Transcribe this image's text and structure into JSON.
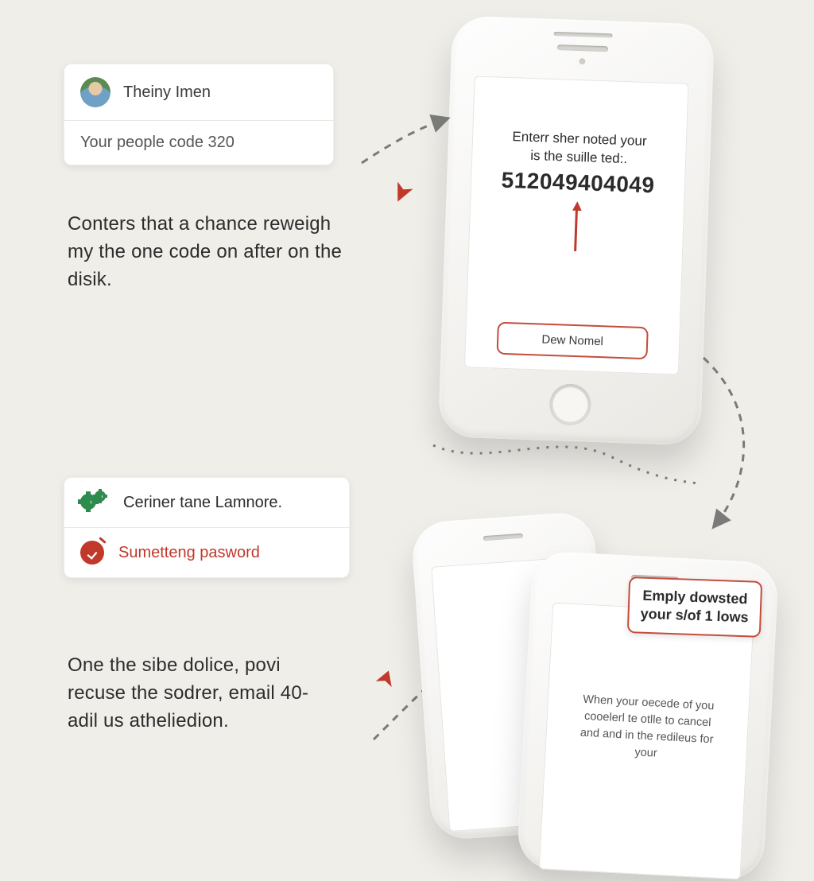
{
  "card_top": {
    "name": "Theiny Imen",
    "code_line": "Your people code 320"
  },
  "paragraph_top": "Conters that a chance reweigh my the one code on after on the disik.",
  "phone_top": {
    "prompt_line1": "Enterr sher noted your",
    "prompt_line2": "is the suille ted:.",
    "code": "512049404049",
    "button": "Dew Nomel"
  },
  "card_bottom": {
    "row1": "Ceriner tane Lamnore.",
    "row2": "Sumetteng pasword"
  },
  "paragraph_bottom": "One the sibe dolice, povi recuse the sodrer, email 40-adil us atheliedion.",
  "callout": {
    "line1": "Emply dowsted",
    "line2": "your s/of 1 lows"
  },
  "phone_bottom_msg": {
    "l1": "When your oecede of you",
    "l2": "cooelerl te otlle to cancel",
    "l3": "and and in the redileus for",
    "l4": "your"
  }
}
